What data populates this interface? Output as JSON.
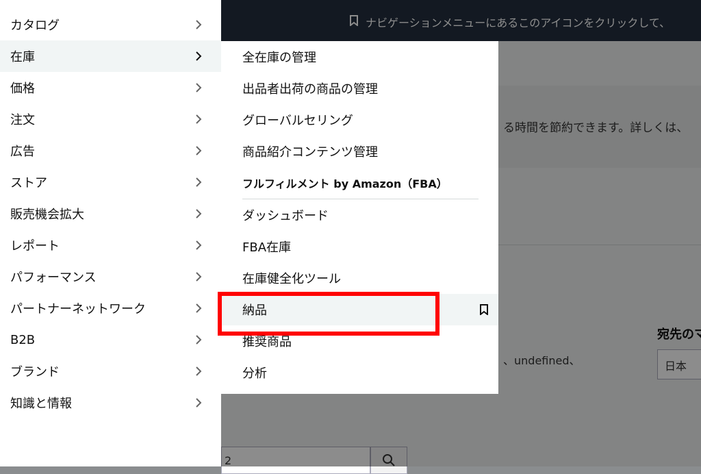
{
  "background": {
    "banner_text": "ナビゲーションメニューにあるこのアイコンをクリックして、",
    "save_text": "る時間を節約できます。詳しくは、",
    "destination_label": "宛先のマ",
    "destination_value": "日本",
    "undefined_text": "、undefined、",
    "search_value": "2"
  },
  "left_nav": {
    "items": [
      {
        "label": "カタログ"
      },
      {
        "label": "在庫"
      },
      {
        "label": "価格"
      },
      {
        "label": "注文"
      },
      {
        "label": "広告"
      },
      {
        "label": "ストア"
      },
      {
        "label": "販売機会拡大"
      },
      {
        "label": "レポート"
      },
      {
        "label": "パフォーマンス"
      },
      {
        "label": "パートナーネットワーク"
      },
      {
        "label": "B2B"
      },
      {
        "label": "ブランド"
      },
      {
        "label": "知識と情報"
      }
    ],
    "active_index": 1
  },
  "submenu": {
    "items_top": [
      {
        "label": "全在庫の管理"
      },
      {
        "label": "出品者出荷の商品の管理"
      },
      {
        "label": "グローバルセリング"
      },
      {
        "label": "商品紹介コンテンツ管理"
      }
    ],
    "section_heading": "フルフィルメント by Amazon（FBA）",
    "items_fba": [
      {
        "label": "ダッシュボード"
      },
      {
        "label": "FBA在庫"
      },
      {
        "label": "在庫健全化ツール"
      },
      {
        "label": "納品"
      },
      {
        "label": "推奨商品"
      },
      {
        "label": "分析"
      }
    ]
  },
  "colors": {
    "highlight_box": "#ff0000",
    "topbar": "#232f3e",
    "hover_bg": "#f1f5f5"
  }
}
